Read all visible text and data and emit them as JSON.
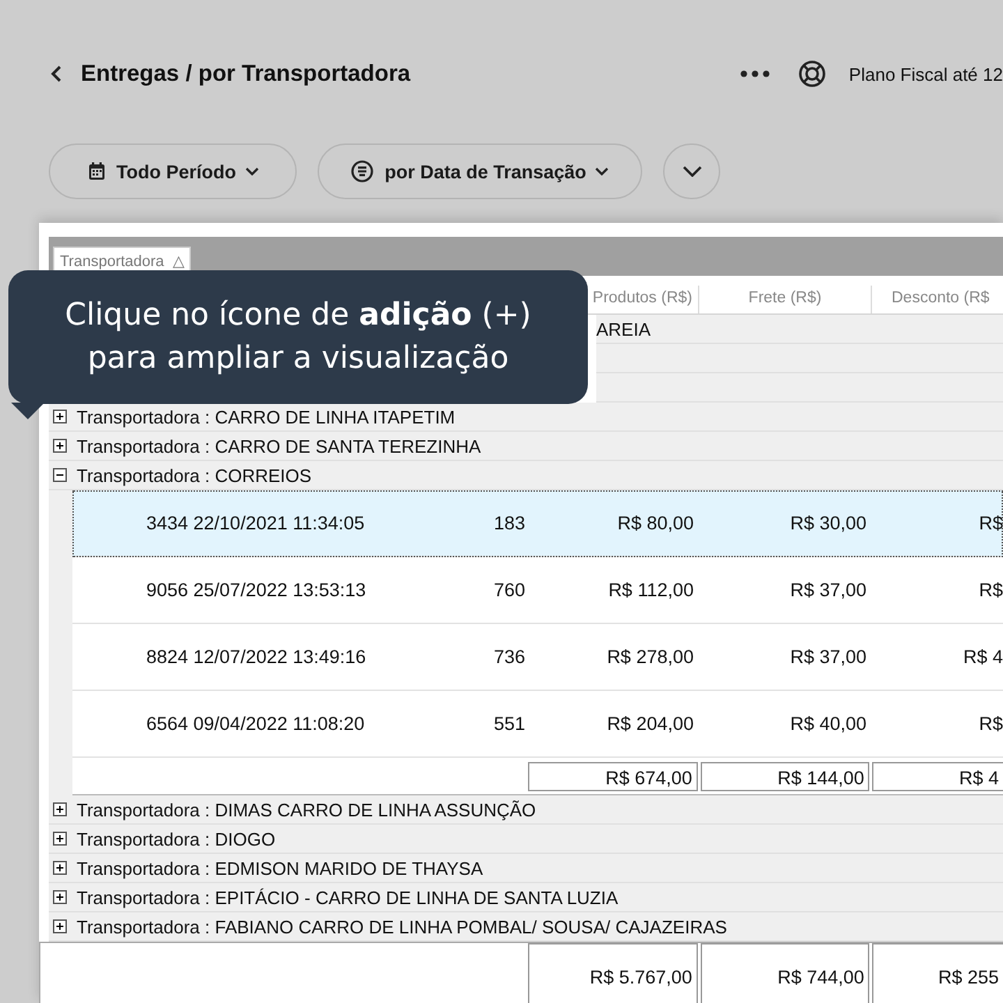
{
  "header": {
    "title": "Entregas / por Transportadora",
    "plan": "Plano Fiscal até 12"
  },
  "filters": [
    {
      "kind": "period",
      "label": "Todo Período"
    },
    {
      "kind": "date",
      "label": "por Data de Transação"
    },
    {
      "kind": "more"
    }
  ],
  "grouping": {
    "chip": "Transportadora",
    "sort_mark": "△"
  },
  "columns": [
    {
      "label": "Produtos (R$)"
    },
    {
      "label": "Frete (R$)"
    },
    {
      "label": "Desconto (R$"
    }
  ],
  "groups": [
    {
      "kind": "covered",
      "label": "AREIA"
    },
    {
      "kind": "group",
      "label": "Transportadora : CARRO DE LINHA ITAPETIM",
      "expanded": false
    },
    {
      "kind": "group",
      "label": "Transportadora : CARRO DE SANTA TEREZINHA",
      "expanded": false
    },
    {
      "kind": "group",
      "label": "Transportadora : CORREIOS",
      "expanded": true,
      "orders": [
        {
          "order": "3434 22/10/2021 11:34:05",
          "qty": "183",
          "products": "R$ 80,00",
          "freight": "R$ 30,00",
          "discount": "R$",
          "selected": true
        },
        {
          "order": "9056 25/07/2022 13:53:13",
          "qty": "760",
          "products": "R$ 112,00",
          "freight": "R$ 37,00",
          "discount": "R$",
          "selected": false
        },
        {
          "order": "8824 12/07/2022 13:49:16",
          "qty": "736",
          "products": "R$ 278,00",
          "freight": "R$ 37,00",
          "discount": "R$ 4",
          "selected": false
        },
        {
          "order": "6564 09/04/2022 11:08:20",
          "qty": "551",
          "products": "R$ 204,00",
          "freight": "R$ 40,00",
          "discount": "R$",
          "selected": false
        }
      ],
      "subtotals": [
        "R$ 674,00",
        "R$ 144,00",
        "R$ 4"
      ]
    },
    {
      "kind": "group",
      "label": "Transportadora : DIMAS CARRO DE LINHA ASSUNÇÃO",
      "expanded": false
    },
    {
      "kind": "group",
      "label": "Transportadora : DIOGO",
      "expanded": false
    },
    {
      "kind": "group",
      "label": "Transportadora : EDMISON MARIDO DE THAYSA",
      "expanded": false
    },
    {
      "kind": "group",
      "label": "Transportadora : EPITÁCIO - CARRO DE LINHA DE SANTA LUZIA",
      "expanded": false
    },
    {
      "kind": "group",
      "label": "Transportadora : FABIANO CARRO DE LINHA POMBAL/ SOUSA/ CAJAZEIRAS",
      "expanded": false
    }
  ],
  "totals": [
    "R$ 5.767,00",
    "R$ 744,00",
    "R$ 255"
  ],
  "tooltip": "Clique no ícone de **adição** (+) para ampliar a visualização"
}
